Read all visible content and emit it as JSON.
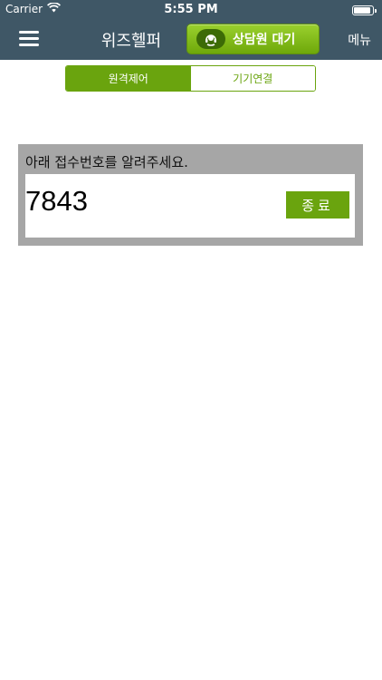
{
  "status_bar": {
    "carrier": "Carrier",
    "time": "5:55 PM"
  },
  "nav": {
    "menu_icon": "hamburger-menu-icon",
    "title": "위즈헬퍼",
    "consult_button_label": "상담원 대기",
    "consult_icon": "headset-icon",
    "menu_label": "메뉴"
  },
  "tabs": [
    {
      "label": "원격제어",
      "active": true
    },
    {
      "label": "기기연결",
      "active": false
    }
  ],
  "panel": {
    "prompt": "아래 접수번호를 알려주세요.",
    "receipt_number": "7843",
    "end_button_label": "종료"
  },
  "colors": {
    "header_bg": "#3f5766",
    "accent_green": "#6aa40e",
    "panel_gray": "#a6a6a6"
  }
}
